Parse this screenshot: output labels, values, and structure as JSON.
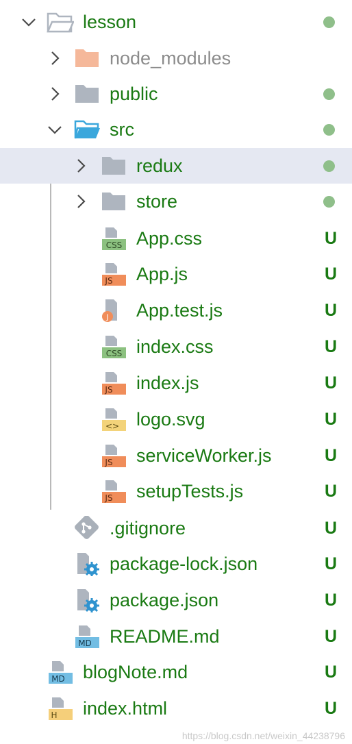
{
  "tree": {
    "lesson": {
      "label": "lesson",
      "status": "dot"
    },
    "node_modules": {
      "label": "node_modules"
    },
    "public": {
      "label": "public",
      "status": "dot"
    },
    "src": {
      "label": "src",
      "status": "dot"
    },
    "redux": {
      "label": "redux",
      "status": "dot"
    },
    "store": {
      "label": "store",
      "status": "dot"
    },
    "app_css": {
      "label": "App.css",
      "badge": "U",
      "icon_text": "CSS"
    },
    "app_js": {
      "label": "App.js",
      "badge": "U",
      "icon_text": "JS"
    },
    "app_test_js": {
      "label": "App.test.js",
      "badge": "U",
      "icon_text": "J"
    },
    "index_css": {
      "label": "index.css",
      "badge": "U",
      "icon_text": "CSS"
    },
    "index_js": {
      "label": "index.js",
      "badge": "U",
      "icon_text": "JS"
    },
    "logo_svg": {
      "label": "logo.svg",
      "badge": "U",
      "icon_text": "<>"
    },
    "service_worker_js": {
      "label": "serviceWorker.js",
      "badge": "U",
      "icon_text": "JS"
    },
    "setup_tests_js": {
      "label": "setupTests.js",
      "badge": "U",
      "icon_text": "JS"
    },
    "gitignore": {
      "label": ".gitignore",
      "badge": "U"
    },
    "package_lock_json": {
      "label": "package-lock.json",
      "badge": "U"
    },
    "package_json": {
      "label": "package.json",
      "badge": "U"
    },
    "readme_md": {
      "label": "README.md",
      "badge": "U",
      "icon_text": "MD"
    },
    "blognote_md": {
      "label": "blogNote.md",
      "badge": "U",
      "icon_text": "MD"
    },
    "index_html": {
      "label": "index.html",
      "badge": "U",
      "icon_text": "H"
    }
  },
  "watermark": "https://blog.csdn.net/weixin_44238796",
  "colors": {
    "label": "#1a7a13",
    "muted_label": "#8c8c8c",
    "status_dot": "#8fbf8a",
    "selected_row": "#e5e8f2",
    "folder": "#aeb5bf",
    "node_modules_folder": "#f5b89a",
    "open_folder": "#3aa7dc",
    "css_badge": "#8cc180",
    "js_badge": "#f08d5a",
    "svg_badge": "#f3d37a",
    "md_badge": "#72bde3",
    "html_badge": "#f5cf7a",
    "gear": "#2f93cf",
    "git": "#a9b0b9"
  }
}
